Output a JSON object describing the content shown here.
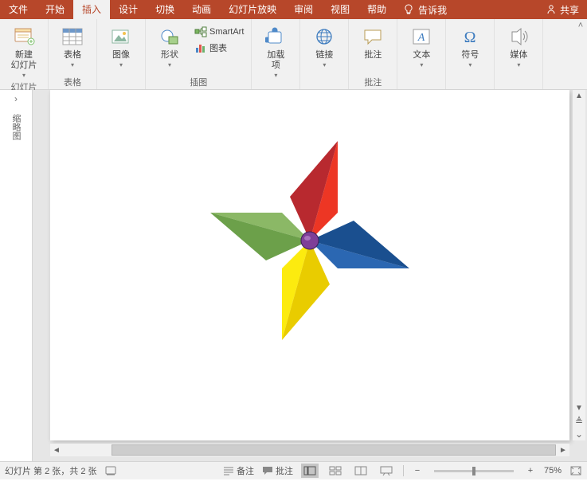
{
  "tabs": {
    "file": "文件",
    "home": "开始",
    "insert": "插入",
    "design": "设计",
    "transitions": "切换",
    "animations": "动画",
    "slideshow": "幻灯片放映",
    "review": "审阅",
    "view": "视图",
    "help": "帮助",
    "tellme": "告诉我",
    "share": "共享"
  },
  "ribbon": {
    "slides": {
      "new_slide": "新建\n幻灯片",
      "group": "幻灯片"
    },
    "tables": {
      "table": "表格",
      "group": "表格"
    },
    "images": {
      "images": "图像"
    },
    "illustrations": {
      "shapes": "形状",
      "smartart": "SmartArt",
      "chart": "图表",
      "group": "插图"
    },
    "addins": {
      "addins": "加载\n项"
    },
    "links": {
      "link": "链接"
    },
    "comments": {
      "comment": "批注",
      "group": "批注"
    },
    "text": {
      "text": "文本"
    },
    "symbols": {
      "symbol": "符号"
    },
    "media": {
      "media": "媒体"
    }
  },
  "nav": {
    "thumbnails": "缩略图"
  },
  "status": {
    "slide_counter": "幻灯片 第 2 张，共 2 张",
    "notes": "备注",
    "comments": "批注",
    "zoom_pct": "75%"
  }
}
